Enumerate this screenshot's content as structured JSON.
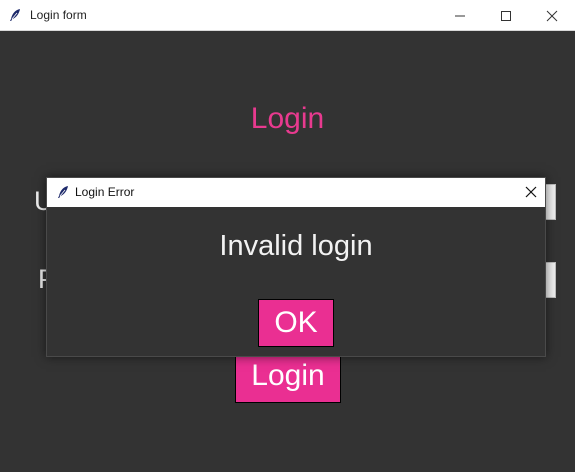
{
  "main_window": {
    "title": "Login form",
    "icon": "feather-icon",
    "controls": [
      "minimize-icon",
      "maximize-icon",
      "close-icon"
    ]
  },
  "form": {
    "heading": "Login",
    "username_label_visible": "U",
    "password_label_visible": "P",
    "login_button": "Login"
  },
  "dialog": {
    "title": "Login Error",
    "icon": "feather-icon",
    "message": "Invalid login",
    "ok_button": "OK"
  },
  "colors": {
    "background": "#333333",
    "accent": "#ea2f92",
    "heading": "#e83a8f",
    "text": "#eeeeee",
    "titlebar": "#ffffff"
  }
}
